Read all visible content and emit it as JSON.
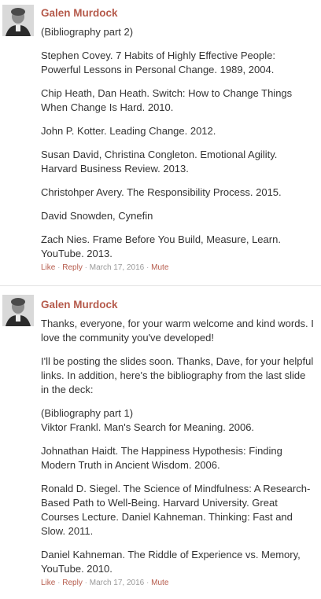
{
  "comments": [
    {
      "author": "Galen Murdock",
      "paragraphs": [
        "(Bibliography part 2)",
        "Stephen Covey. 7 Habits of Highly Effective People: Powerful Lessons in Personal Change. 1989, 2004.",
        "Chip Heath, Dan Heath. Switch: How to Change Things When Change Is Hard. 2010.",
        "John P. Kotter. Leading Change. 2012.",
        "Susan David, Christina Congleton. Emotional Agility. Harvard Business Review. 2013.",
        "Christohper Avery. The Responsibility Process. 2015.",
        "David Snowden, Cynefin",
        "Zach Nies. Frame Before You Build, Measure, Learn. YouTube. 2013."
      ],
      "like": "Like",
      "reply": "Reply",
      "date": "March 17, 2016",
      "mute": "Mute",
      "sep": "·"
    },
    {
      "author": "Galen Murdock",
      "paragraphs": [
        "Thanks, everyone, for your warm welcome and kind words. I love the community you've developed!",
        "I'll be posting the slides soon. Thanks, Dave, for your helpful links. In addition, here's the bibliography from the last slide in the deck:",
        "(Bibliography part 1)\nViktor Frankl. Man's Search for Meaning. 2006.",
        "Johnathan Haidt. The Happiness Hypothesis: Finding Modern Truth in Ancient Wisdom. 2006.",
        "Ronald D. Siegel. The Science of Mindfulness: A Research-Based Path to Well-Being. Harvard University. Great Courses Lecture. Daniel Kahneman. Thinking: Fast and Slow. 2011.",
        "Daniel Kahneman. The Riddle of Experience vs. Memory, YouTube. 2010."
      ],
      "like": "Like",
      "reply": "Reply",
      "date": "March 17, 2016",
      "mute": "Mute",
      "sep": "·"
    }
  ]
}
